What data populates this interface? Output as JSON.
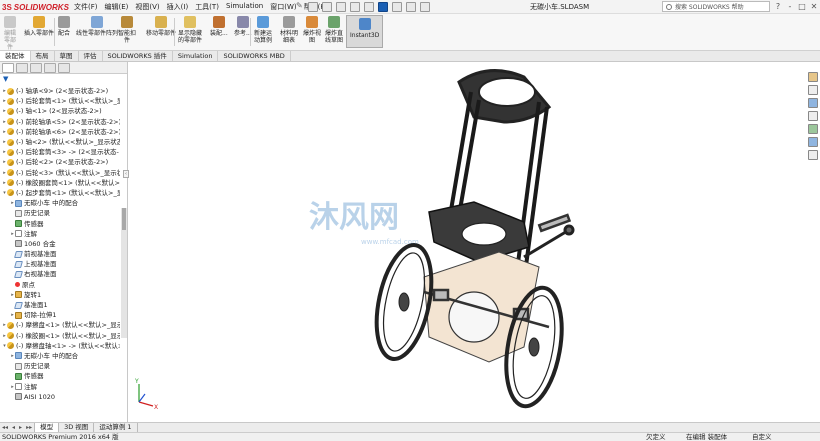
{
  "app": {
    "brand_ds": "3S",
    "brand_name": "SOLIDWORKS",
    "document_title": "无碳小车.SLDASM",
    "search_placeholder": "搜索 SOLIDWORKS 帮助"
  },
  "menu": [
    "文件(F)",
    "编辑(E)",
    "视图(V)",
    "插入(I)",
    "工具(T)",
    "Simulation",
    "窗口(W)",
    "帮助(H)"
  ],
  "window_controls": {
    "question": "?",
    "minimize": "-",
    "restore": "□",
    "close": "✕"
  },
  "ribbon": {
    "buttons": [
      {
        "label": "编辑\n零部\n件",
        "icon_color": "#c9c9c9",
        "dim": true
      },
      {
        "label": "插入零部件",
        "icon_color": "#e2a834"
      },
      {
        "label": "配合",
        "icon_color": "#9a9a9a"
      },
      {
        "label": "线性零部件阵列",
        "icon_color": "#7fa6d6"
      },
      {
        "label": "智能扣\n件",
        "icon_color": "#b88a3a"
      },
      {
        "label": "移动零部件",
        "icon_color": "#d9b14f"
      },
      {
        "label": "显示隐藏\n的零部件",
        "icon_color": "#e0c060"
      },
      {
        "label": "装配...",
        "icon_color": "#c07030"
      },
      {
        "label": "参考...",
        "icon_color": "#8888aa"
      },
      {
        "label": "新建运\n动算例",
        "icon_color": "#5a9ad9"
      },
      {
        "label": "材料明\n细表",
        "icon_color": "#9b9b9b"
      },
      {
        "label": "爆炸视\n图",
        "icon_color": "#d98a3a"
      },
      {
        "label": "爆炸直\n线草图",
        "icon_color": "#6ba36b"
      },
      {
        "label": "Instant3D",
        "icon_color": "#4e86c9",
        "active": true
      }
    ]
  },
  "command_tabs": [
    "装配体",
    "布局",
    "草图",
    "评估",
    "SOLIDWORKS 插件",
    "Simulation",
    "SOLIDWORKS MBD"
  ],
  "tree": {
    "rows": [
      {
        "indent": 0,
        "expander": "▸",
        "icon": "part",
        "label": "(-) 轴承<9> (2<显示状态-2>)"
      },
      {
        "indent": 0,
        "expander": "▸",
        "icon": "part",
        "label": "(-) 后轮套筒<1> (默认<<默认>_显"
      },
      {
        "indent": 0,
        "expander": "▸",
        "icon": "part",
        "label": "(-) 轴<1> (2<显示状态-2>)"
      },
      {
        "indent": 0,
        "expander": "▸",
        "icon": "part",
        "label": "(-) 前轮轴承<5> (2<显示状态-2>)"
      },
      {
        "indent": 0,
        "expander": "▸",
        "icon": "part",
        "label": "(-) 前轮轴承<6> (2<显示状态-2>)"
      },
      {
        "indent": 0,
        "expander": "▸",
        "icon": "part",
        "label": "(-) 轴<2> (默认<<默认>_显示状态"
      },
      {
        "indent": 0,
        "expander": "▸",
        "icon": "part",
        "label": "(-) 后轮套筒<3> -> (2<显示状态-"
      },
      {
        "indent": 0,
        "expander": "▸",
        "icon": "part",
        "label": "(-) 后轮<2> (2<显示状态-2>)"
      },
      {
        "indent": 0,
        "expander": "▸",
        "icon": "part",
        "label": "(-) 后轮<3> (默认<<默认>_显示状"
      },
      {
        "indent": 0,
        "expander": "▸",
        "icon": "part",
        "label": "(-) 橡胶圈套筒<1> (默认<<默认>_"
      },
      {
        "indent": 0,
        "expander": "▾",
        "icon": "part",
        "label": "(-) 起步套筒<1> (默认<<默认>_显"
      },
      {
        "indent": 1,
        "expander": "▸",
        "icon": "folder",
        "label": "无碳小车 中的配合"
      },
      {
        "indent": 1,
        "expander": "",
        "icon": "doc",
        "label": "历史记录"
      },
      {
        "indent": 1,
        "expander": "",
        "icon": "sensor",
        "label": "传感器"
      },
      {
        "indent": 1,
        "expander": "▸",
        "icon": "ann",
        "label": "注解"
      },
      {
        "indent": 1,
        "expander": "",
        "icon": "mat",
        "label": "1060 合金"
      },
      {
        "indent": 1,
        "expander": "",
        "icon": "plane",
        "label": "前视基准面"
      },
      {
        "indent": 1,
        "expander": "",
        "icon": "plane",
        "label": "上视基准面"
      },
      {
        "indent": 1,
        "expander": "",
        "icon": "plane",
        "label": "右视基准面"
      },
      {
        "indent": 1,
        "expander": "",
        "icon": "origin",
        "label": "原点"
      },
      {
        "indent": 1,
        "expander": "▸",
        "icon": "feat",
        "label": "旋转1"
      },
      {
        "indent": 1,
        "expander": "",
        "icon": "plane",
        "label": "基准面1"
      },
      {
        "indent": 1,
        "expander": "▸",
        "icon": "feat",
        "label": "切除-拉伸1"
      },
      {
        "indent": 0,
        "expander": "▸",
        "icon": "part",
        "label": "(-) 摩擦盘<1> (默认<<默认>_显示"
      },
      {
        "indent": 0,
        "expander": "▸",
        "icon": "part",
        "label": "(-) 橡胶圈<1> (默认<<默认>_显示"
      },
      {
        "indent": 0,
        "expander": "▾",
        "icon": "part",
        "label": "(-) 摩擦盘轴<1> -> (默认<<默认>_"
      },
      {
        "indent": 1,
        "expander": "▸",
        "icon": "folder",
        "label": "无碳小车 中的配合"
      },
      {
        "indent": 1,
        "expander": "",
        "icon": "doc",
        "label": "历史记录"
      },
      {
        "indent": 1,
        "expander": "",
        "icon": "sensor",
        "label": "传感器"
      },
      {
        "indent": 1,
        "expander": "▸",
        "icon": "ann",
        "label": "注解"
      },
      {
        "indent": 1,
        "expander": "",
        "icon": "mat",
        "label": "AISI 1020"
      }
    ]
  },
  "viewport": {
    "watermark_text": "沐风网",
    "watermark_url": "www.mfcad.com",
    "triad_labels": {
      "x": "X",
      "y": "Y"
    }
  },
  "bottom_tabs": [
    "模型",
    "3D 视图",
    "运动算例 1"
  ],
  "status": {
    "left": "SOLIDWORKS Premium 2016 x64 版",
    "under_defined": "欠定义",
    "editing": "在编辑 装配体",
    "custom": "自定义"
  }
}
